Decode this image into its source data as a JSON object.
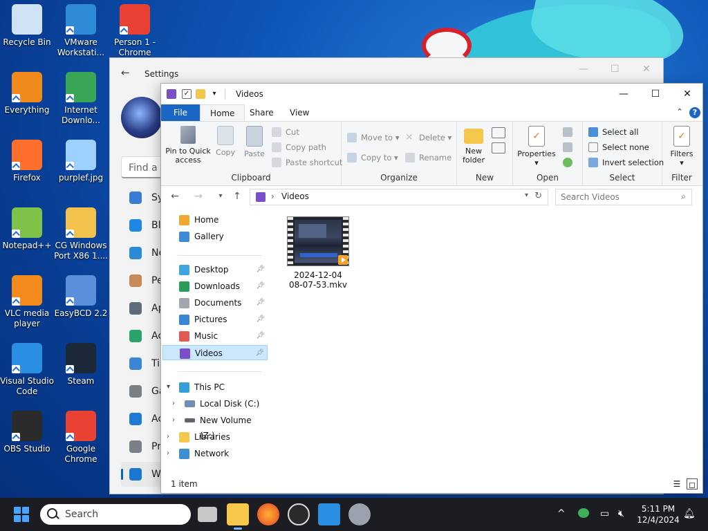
{
  "desktop": {
    "icons": [
      {
        "label": "Recycle Bin",
        "color": "#cfe3f5"
      },
      {
        "label": "VMware Workstati...",
        "color": "#2f8ad8"
      },
      {
        "label": "Person 1 - Chrome",
        "color": "#e94235"
      },
      {
        "label": "Everything",
        "color": "#f08a1c"
      },
      {
        "label": "Internet Downlo...",
        "color": "#3aa655"
      },
      {
        "label": "Firefox",
        "color": "#ff6f2c"
      },
      {
        "label": "purplef.jpg",
        "color": "#9fd1ff"
      },
      {
        "label": "Notepad++",
        "color": "#7fc24a"
      },
      {
        "label": "CG Windows Port X86 1....",
        "color": "#f2c24d"
      },
      {
        "label": "VLC media player",
        "color": "#f28b1c"
      },
      {
        "label": "EasyBCD 2.2",
        "color": "#5b8fd9"
      },
      {
        "label": "Visual Studio Code",
        "color": "#2a8fe2"
      },
      {
        "label": "Steam",
        "color": "#1b2838"
      },
      {
        "label": "OBS Studio",
        "color": "#2b2b2b"
      },
      {
        "label": "Google Chrome",
        "color": "#e94235"
      }
    ]
  },
  "settings": {
    "title": "Settings",
    "search_placeholder": "Find a s",
    "nav": [
      "Sy",
      "Bl",
      "Ne",
      "Pe",
      "Ap",
      "Ac",
      "Ti",
      "Ga",
      "Ac",
      "Pr",
      "W"
    ]
  },
  "explorer": {
    "title": "Videos",
    "tabs": {
      "file": "File",
      "home": "Home",
      "share": "Share",
      "view": "View"
    },
    "ribbon": {
      "clipboard": {
        "label": "Clipboard",
        "pin": "Pin to Quick access",
        "copy": "Copy",
        "paste": "Paste",
        "cut": "Cut",
        "copy_path": "Copy path",
        "paste_shortcut": "Paste shortcut"
      },
      "organize": {
        "label": "Organize",
        "move_to": "Move to",
        "copy_to": "Copy to",
        "delete": "Delete",
        "rename": "Rename"
      },
      "new": {
        "label": "New",
        "new_folder": "New folder"
      },
      "open": {
        "label": "Open",
        "properties": "Properties"
      },
      "select": {
        "label": "Select",
        "select_all": "Select all",
        "select_none": "Select none",
        "invert": "Invert selection"
      },
      "filter": {
        "label": "Filter",
        "filters": "Filters"
      }
    },
    "address": {
      "crumb": "Videos",
      "search_placeholder": "Search Videos"
    },
    "nav_pane": {
      "home": "Home",
      "gallery": "Gallery",
      "quick": [
        "Desktop",
        "Downloads",
        "Documents",
        "Pictures",
        "Music",
        "Videos"
      ],
      "this_pc": "This PC",
      "drives": [
        "Local Disk (C:)",
        "New Volume (Z:)"
      ],
      "libraries": "Libraries",
      "network": "Network"
    },
    "files": [
      {
        "name_line1": "2024-12-04",
        "name_line2": "08-07-53.mkv"
      }
    ],
    "status": {
      "count": "1 item"
    }
  },
  "taskbar": {
    "search_label": "Search",
    "time": "5:11 PM",
    "date": "12/4/2024"
  }
}
